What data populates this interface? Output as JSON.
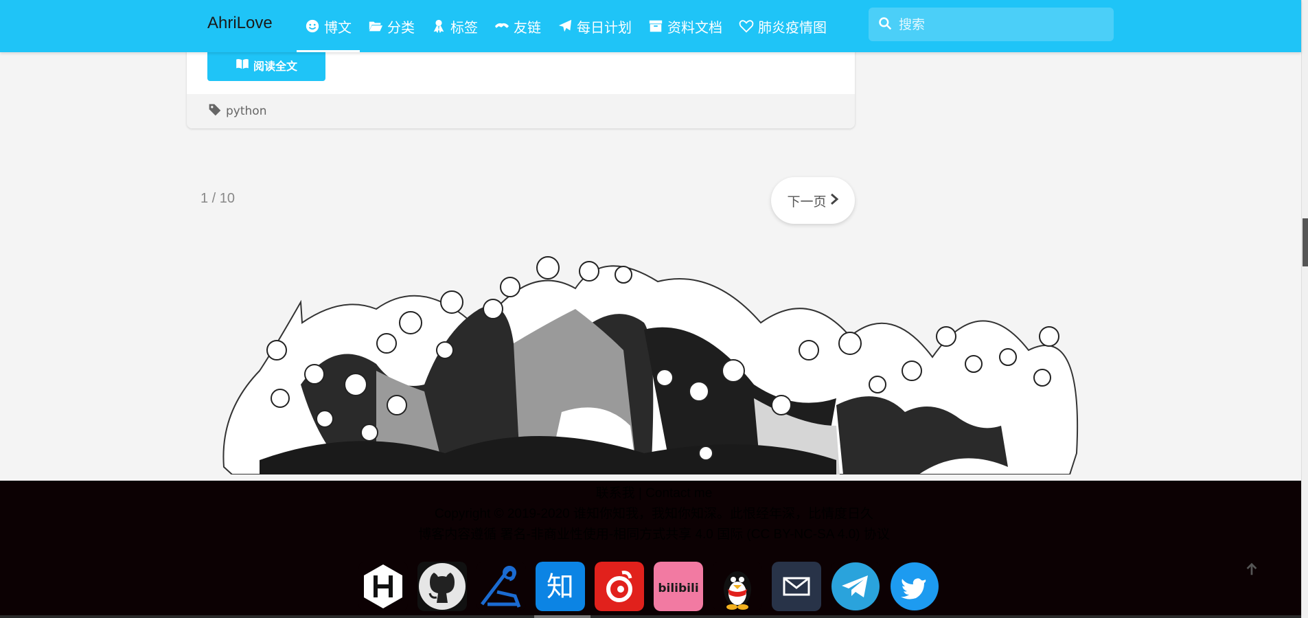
{
  "brand": "AhriLove",
  "nav": [
    {
      "label": "博文",
      "icon": "smile-icon",
      "active": true
    },
    {
      "label": "分类",
      "icon": "folder-open-icon",
      "active": false
    },
    {
      "label": "标签",
      "icon": "ribbon-icon",
      "active": false
    },
    {
      "label": "友链",
      "icon": "handshake-icon",
      "active": false
    },
    {
      "label": "每日计划",
      "icon": "paper-plane-icon",
      "active": false
    },
    {
      "label": "资料文档",
      "icon": "archive-icon",
      "active": false
    },
    {
      "label": "肺炎疫情图",
      "icon": "heart-icon",
      "active": false
    }
  ],
  "search": {
    "placeholder": "搜索"
  },
  "post": {
    "read_more": "阅读全文",
    "tag": "python"
  },
  "pagination": {
    "info": "1 / 10",
    "next": "下一页"
  },
  "footer": {
    "contact": "联系我 | Contact me",
    "copyright": "Copyright © 2019-2020 谁知你知我，我知你知深。此恨经年深，比情度日久",
    "license": "博客内容遵循 署名-非商业性使用-相同方式共享 4.0 国际 (CC BY-NC-SA 4.0) 协议"
  },
  "socials": [
    {
      "name": "hexo",
      "icon": "hexo-icon",
      "color": "#ffffff"
    },
    {
      "name": "github",
      "icon": "github-icon",
      "color": "#ffffff"
    },
    {
      "name": "leetcode",
      "icon": "leetcode-icon",
      "color": "#0e3fa1"
    },
    {
      "name": "zhihu",
      "icon": "zhihu-icon",
      "color": "#0c84e4",
      "text": "知"
    },
    {
      "name": "netease-music",
      "icon": "netease-music-icon",
      "color": "#e1211c"
    },
    {
      "name": "bilibili",
      "icon": "bilibili-icon",
      "color": "#f27aa2",
      "text": "bilibili"
    },
    {
      "name": "qq",
      "icon": "qq-penguin-icon",
      "color": "#000000"
    },
    {
      "name": "email",
      "icon": "mail-icon",
      "color": "#283348"
    },
    {
      "name": "telegram",
      "icon": "telegram-icon",
      "color": "#2aa3dc"
    },
    {
      "name": "twitter",
      "icon": "twitter-icon",
      "color": "#1d9bf0"
    }
  ],
  "colors": {
    "accent": "#1fc4f7",
    "footer_bg": "#0c0103",
    "page_bg": "#f4f4f4"
  }
}
